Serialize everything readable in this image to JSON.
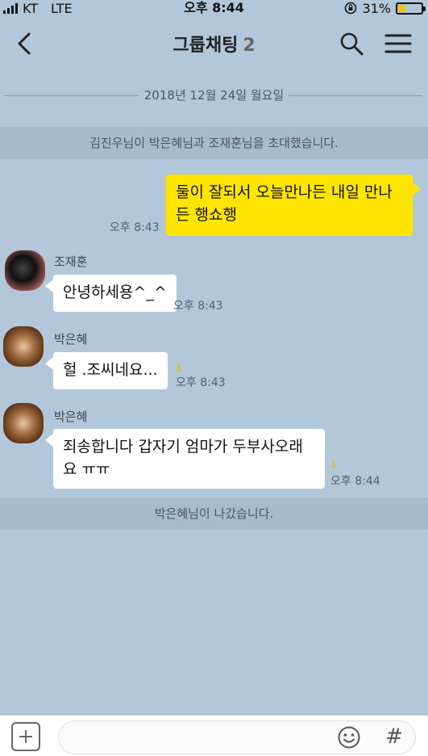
{
  "status_bar": {
    "carrier": "KT",
    "network": "LTE",
    "time": "오후 8:44",
    "battery": "31%",
    "battery_level": 0.31
  },
  "header": {
    "title": "그룹채팅",
    "member_count": "2"
  },
  "date_divider": "2018년 12월 24일 월요일",
  "system_messages": {
    "invite": "김진우님이 박은혜님과 조재훈님을 초대했습니다.",
    "left": "박은혜님이 나갔습니다."
  },
  "messages": [
    {
      "sender": "",
      "mine": true,
      "lines": [
        "둘이 잘되서 오늘만나든 내일 만나",
        "든 행쇼행"
      ],
      "time": "오후 8:43",
      "unread": ""
    },
    {
      "sender": "조재훈",
      "mine": false,
      "lines": [
        "안녕하세용^_^"
      ],
      "time": "오후 8:43",
      "unread": ""
    },
    {
      "sender": "박은혜",
      "mine": false,
      "lines": [
        "헐 .조씨네요..."
      ],
      "time": "오후 8:43",
      "unread": "1"
    },
    {
      "sender": "박은혜",
      "mine": false,
      "lines": [
        "죄송합니다 갑자기 엄마가 두부사오래",
        "요 ㅠㅠ"
      ],
      "time": "오후 8:44",
      "unread": "1"
    }
  ],
  "icons": {
    "back": "chevron-left-icon",
    "search": "search-icon",
    "menu": "hamburger-menu-icon",
    "add": "plus-icon",
    "emoji": "smiley-icon",
    "hashtag": "hashtag-icon"
  },
  "colors": {
    "background": "#b2c7d9",
    "my_bubble": "#fee500",
    "their_bubble": "#ffffff"
  }
}
